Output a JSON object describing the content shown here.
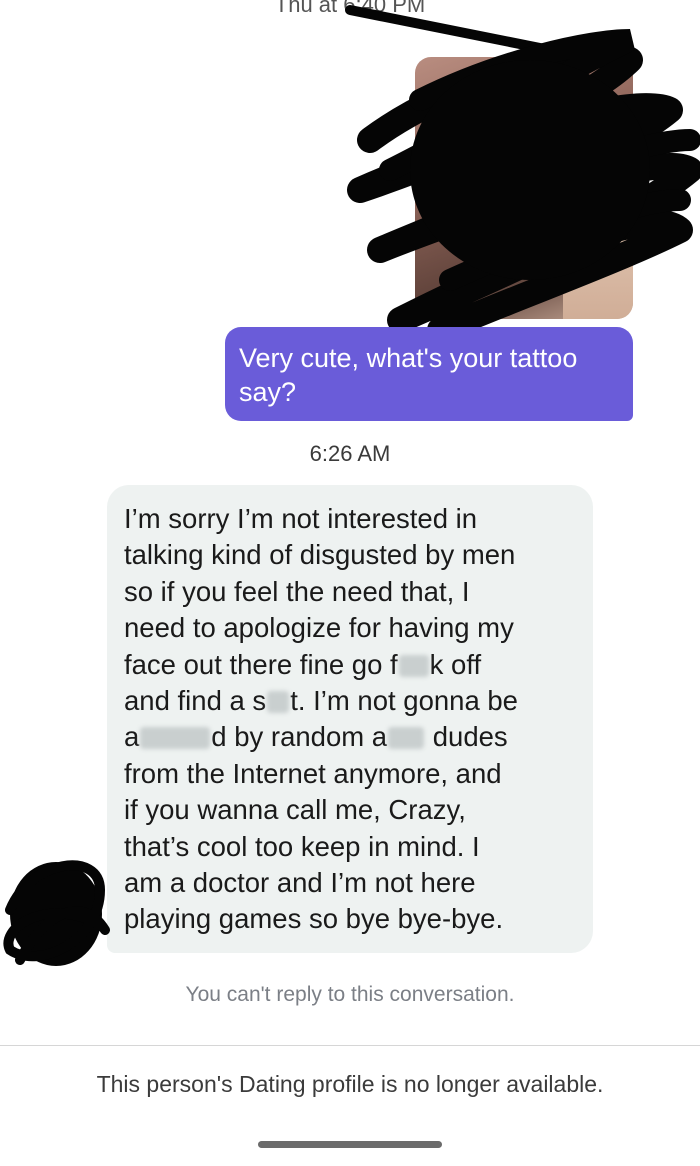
{
  "header": {
    "timestamp": "Thu at 6:40 PM"
  },
  "messages": {
    "sent": {
      "line1": "Very cute, what's your tattoo",
      "line2": "say?"
    },
    "time_label": "6:26 AM",
    "received": {
      "lines": [
        "I’m sorry I’m not interested in",
        "talking kind of disgusted by men",
        "so if you feel the need that, I",
        "need to apologize for having my",
        "face out there fine go f",
        "k off",
        "and find a s",
        "t. I’m not gonna be",
        "a",
        "d by random a",
        "dudes",
        "from the Internet anymore, and",
        "if you wanna call me, Crazy,",
        "that’s cool too keep in mind. I",
        "am a doctor and I’m not here",
        "playing games so bye bye-bye."
      ]
    }
  },
  "footer": {
    "notice": "You can't reply to this conversation.",
    "profile_status": "This person's Dating profile is no longer available."
  },
  "colors": {
    "sent_bubble": "#6a5cd9",
    "received_bubble": "#eef2f1",
    "notice_text": "#7b7f86"
  }
}
